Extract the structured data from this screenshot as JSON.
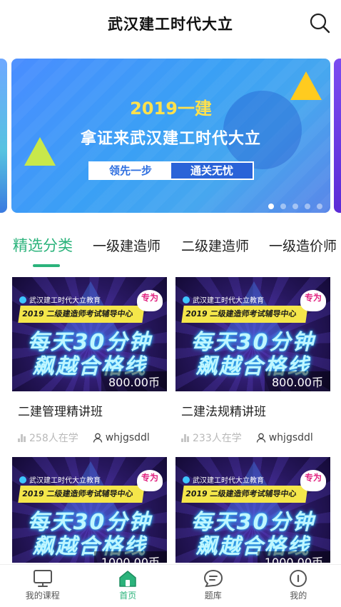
{
  "header": {
    "title": "武汉建工时代大立"
  },
  "banner": {
    "year_text": "2019一建",
    "headline": "拿证来武汉建工时代大立",
    "pill_left": "领先一步",
    "pill_right": "通关无忧",
    "active_slide": 1,
    "slide_count": 5
  },
  "tabs": [
    {
      "label": "精选分类",
      "active": true
    },
    {
      "label": "一级建造师",
      "active": false
    },
    {
      "label": "二级建造师",
      "active": false
    },
    {
      "label": "一级造价师",
      "active": false
    }
  ],
  "course_thumb": {
    "org": "武汉建工时代大立教育",
    "strip": "2019 二级建造师考试辅导中心",
    "badge": "专为",
    "slogan1": "每天30分钟",
    "slogan2": "飙越合格线"
  },
  "courses": [
    {
      "title": "二建管理精讲班",
      "price": "800.00币",
      "learners": "258人在学",
      "author": "whjgsddl"
    },
    {
      "title": "二建法规精讲班",
      "price": "800.00币",
      "learners": "233人在学",
      "author": "whjgsddl"
    },
    {
      "title": "",
      "price": "1000.00币",
      "learners": "",
      "author": ""
    },
    {
      "title": "",
      "price": "1000.00币",
      "learners": "",
      "author": ""
    }
  ],
  "bottom_nav": [
    {
      "label": "我的课程",
      "icon": "tv-icon",
      "active": false
    },
    {
      "label": "首页",
      "icon": "home-icon",
      "active": true
    },
    {
      "label": "题库",
      "icon": "question-bank-icon",
      "active": false
    },
    {
      "label": "我的",
      "icon": "profile-icon",
      "active": false
    }
  ],
  "colors": {
    "accent": "#2bb37b",
    "banner_blue": "#3aa0f5",
    "year_yellow": "#ffe14d"
  }
}
